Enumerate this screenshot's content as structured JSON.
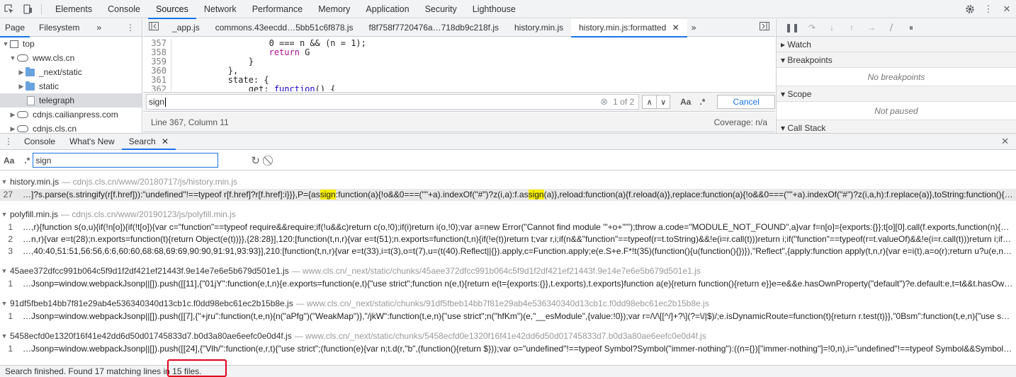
{
  "toolbar": {
    "tabs": [
      "Elements",
      "Console",
      "Sources",
      "Network",
      "Performance",
      "Memory",
      "Application",
      "Security",
      "Lighthouse"
    ],
    "active_tab": "Sources"
  },
  "navigator": {
    "tabs": [
      "Page",
      "Filesystem"
    ],
    "more": "»",
    "tree": [
      {
        "label": "top"
      },
      {
        "label": "www.cls.cn"
      },
      {
        "label": "_next/static"
      },
      {
        "label": "static"
      },
      {
        "label": "telegraph"
      },
      {
        "label": "cdnjs.cailianpress.com"
      },
      {
        "label": "cdnjs.cls.cn"
      }
    ]
  },
  "editor": {
    "tabs": [
      "_app.js",
      "commons.43eecdd…5bb51c6f878.js",
      "f8f758f7720476a…718db9c218f.js",
      "history.min.js",
      "history.min.js:formatted"
    ],
    "more": "»",
    "code_lines": [
      {
        "n": "357",
        "text": "                0 === n && (n = 1);"
      },
      {
        "n": "358",
        "kw": "return",
        "text": " G"
      },
      {
        "n": "359",
        "text": "            }"
      },
      {
        "n": "360",
        "text": "        },"
      },
      {
        "n": "361",
        "text": "        state: {"
      },
      {
        "n": "362",
        "prefix": "            get: ",
        "fn": "function",
        "text": "() {"
      }
    ],
    "find": {
      "query": "sign",
      "count": "1 of 2",
      "aa": "Aa",
      "regex": ".*",
      "cancel": "Cancel"
    },
    "status_left": "Line 367, Column 11",
    "status_right": "Coverage: n/a"
  },
  "debugger": {
    "panes": [
      {
        "title": "Watch"
      },
      {
        "title": "Breakpoints",
        "body": "No breakpoints"
      },
      {
        "title": "Scope",
        "body": "Not paused"
      },
      {
        "title": "Call Stack"
      }
    ]
  },
  "drawer": {
    "tabs": [
      "Console",
      "What's New",
      "Search"
    ],
    "active_tab": "Search",
    "aa": "Aa",
    "regex": ".*",
    "query": "sign"
  },
  "results": [
    {
      "file": "history.min.js",
      "path": "— cdnjs.cls.cn/www/20180717/js/history.min.js",
      "matches": [
        {
          "line": "27",
          "pre": "…]?s.parse(s.stringify(r[f.href])):\"undefined\"!==typeof r[f.href]?r[f.href]:i}}},P={as",
          "hit1": "sign",
          "mid": ":function(a){!o&&0===(\"\"+a).indexOf(\"#\")?z(i,a):f.as",
          "hit2": "sign",
          "post": "(a)},reload:function(a){f.reload(a)},replace:function(a){!o&&0===(\"\"+a).indexOf(\"#\")?z(i,a,h):f.replace(a)},toString:function(){ret…"
        }
      ]
    },
    {
      "file": "polyfill.min.js",
      "path": "— cdnjs.cls.cn/www/20190123/js/polyfill.min.js",
      "matches": [
        {
          "line": "1",
          "text": "…,r){function s(o,u){if(!n[o]){if(!t[o]){var c=\"function\"==typeof require&&require;if(!u&&c)return c(o,!0);if(i)return i(o,!0);var a=new Error(\"Cannot find module '\"+o+\"'\");throw a.code=\"MODULE_NOT_FOUND\",a}var f=n[o]={exports:{}};t[o][0].call(f.exports,function(n){var…"
        },
        {
          "line": "2",
          "text": "…n,r){var e=t(28);n.exports=function(t){return Object(e(t))}},{28:28}],120:[function(t,n,r){var e=t(51);n.exports=function(t,n){if(!e(t))return t;var r,i;if(n&&\"function\"==typeof(r=t.toString)&&!e(i=r.call(t)))return i;if(\"function\"==typeof(r=t.valueOf)&&!e(i=r.call(t)))return i;if(!n&…"
        },
        {
          "line": "3",
          "text": "…,40:40,51:51,56:56,6:6,60:60,68:68,69:69,90:90,91:91,93:93}],210:[function(t,n,r){var e=t(33),i=t(3),o=t(7),u=(t(40).Reflect||{}).apply,c=Function.apply;e(e.S+e.F*!t(35)(function(){u(function(){})}),\"Reflect\",{apply:function apply(t,n,r){var e=i(t),a=o(r);return u?u(e,n,a):c…"
        }
      ]
    },
    {
      "file": "45aee372dfcc991b064c5f9d1f2df421ef21443f.9e14e7e6e5b679d501e1.js",
      "path": "— www.cls.cn/_next/static/chunks/45aee372dfcc991b064c5f9d1f2df421ef21443f.9e14e7e6e5b679d501e1.js",
      "matches": [
        {
          "line": "1",
          "text": "…Jsonp=window.webpackJsonp||[]).push([[11],{\"01jY\":function(e,t,n){e.exports=function(e,t){\"use strict\";function n(e,t){return e(t={exports:{}},t.exports),t.exports}function a(e){return function(){return e}}e=e&&e.hasOwnProperty(\"default\")?e.default:e,t=t&&t.hasOw…"
        }
      ]
    },
    {
      "file": "91df5fbeb14bb7f81e29ab4e536340340d13cb1c.f0dd98ebc61ec2b15b8e.js",
      "path": "— www.cls.cn/_next/static/chunks/91df5fbeb14bb7f81e29ab4e536340340d13cb1c.f0dd98ebc61ec2b15b8e.js",
      "matches": [
        {
          "line": "1",
          "text": "…Jsonp=window.webpackJsonp||[]).push([[7],{\"+jru\":function(t,e,n){n(\"aPfg\")(\"WeakMap\")},\"/jkW\":function(t,e,n){\"use strict\";n(\"hfKm\")(e,\"__esModule\",{value:!0});var r=/\\/\\[[^/]+?\\](?=\\/|$)/;e.isDynamicRoute=function(t){return r.test(t)}},\"0Bsm\":function(t,e,n){\"use s…"
        }
      ]
    },
    {
      "file": "5458ecfd0e1320f16f41e42dd6d50d01745833d7.b0d3a80ae6eefc0e0d4f.js",
      "path": "— www.cls.cn/_next/static/chunks/5458ecfd0e1320f16f41e42dd6d50d01745833d7.b0d3a80ae6eefc0e0d4f.js",
      "matches": [
        {
          "line": "1",
          "text": "…Jsonp=window.webpackJsonp||[]).push([[24],{\"Vlh/\":function(e,r,t){\"use strict\";(function(e){var n;t.d(r,\"b\",(function(){return $}));var o=\"undefined\"!==typeof Symbol?Symbol(\"immer-nothing\"):((n={})[\"immer-nothing\"]=!0,n),i=\"undefined\"!==typeof Symbol&&Symbol…"
        }
      ]
    }
  ],
  "status": "Search finished.  Found 17 matching lines in 15 files."
}
